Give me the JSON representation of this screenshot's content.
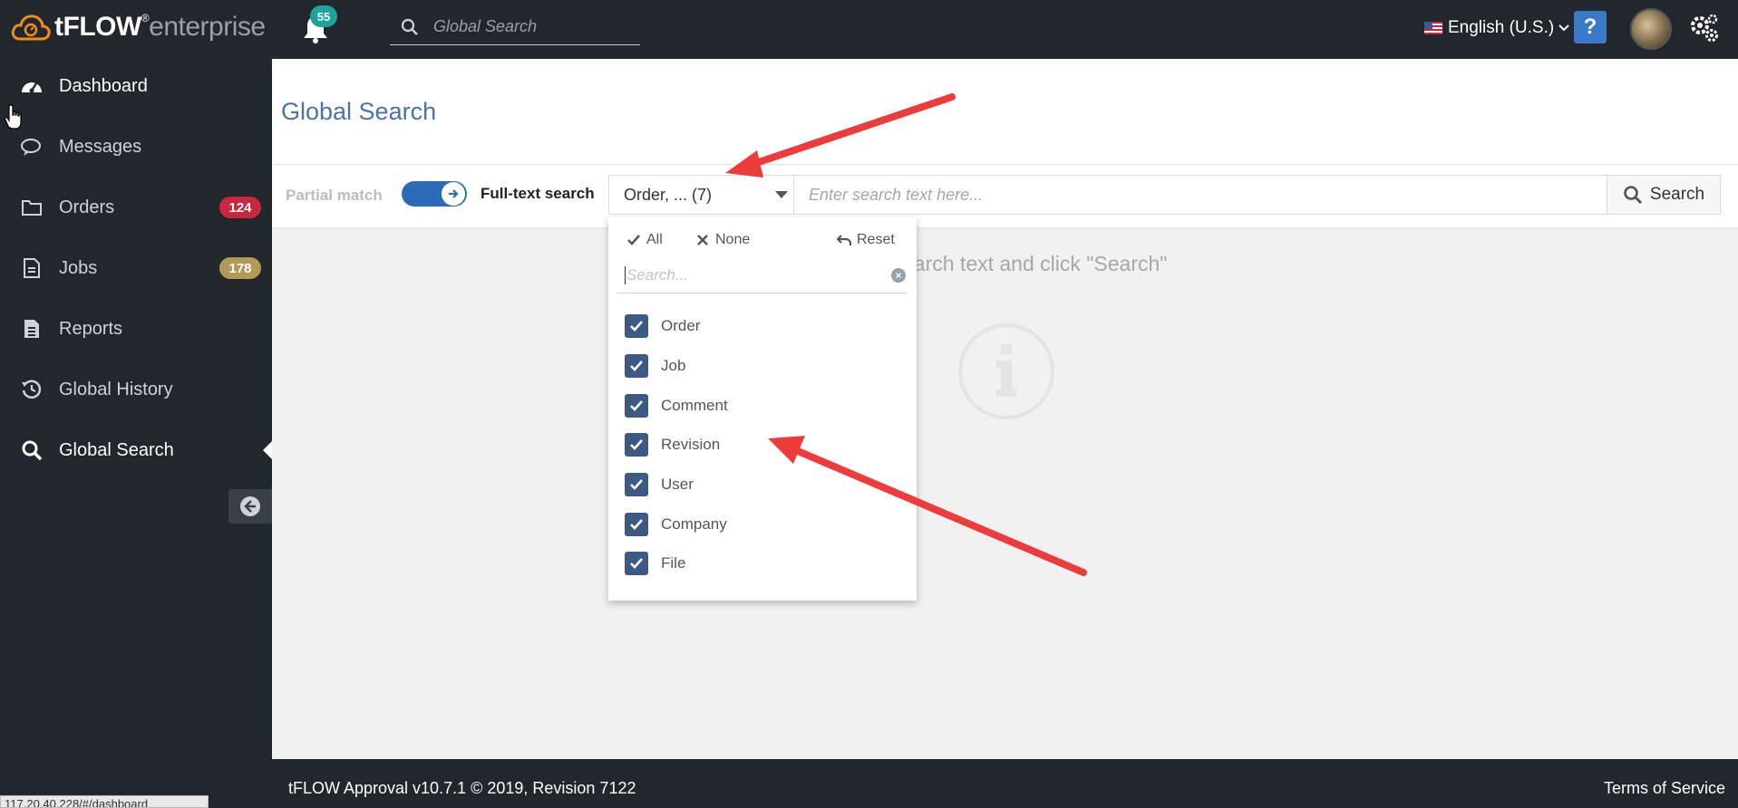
{
  "brand": {
    "name": "tFLOW",
    "registered": "®",
    "edition": "enterprise",
    "accent": "#f28c1b"
  },
  "header": {
    "notifications_count": "55",
    "search_placeholder": "Global Search",
    "language": "English (U.S.)",
    "help_label": "?"
  },
  "sidebar": {
    "items": [
      {
        "label": "Dashboard",
        "icon": "dashboard-icon"
      },
      {
        "label": "Messages",
        "icon": "messages-icon"
      },
      {
        "label": "Orders",
        "icon": "folder-icon",
        "badge": "124",
        "badge_color": "#c8283f"
      },
      {
        "label": "Jobs",
        "icon": "document-icon",
        "badge": "178",
        "badge_color": "#b19a55"
      },
      {
        "label": "Reports",
        "icon": "report-icon"
      },
      {
        "label": "Global History",
        "icon": "history-icon"
      },
      {
        "label": "Global Search",
        "icon": "search-icon",
        "active": true
      }
    ]
  },
  "page": {
    "title": "Global Search",
    "partial_match_label": "Partial match",
    "fulltext_label": "Full-text search",
    "type_select_value": "Order, ... (7)",
    "search_placeholder": "Enter search text here...",
    "search_button": "Search",
    "hint": "earch text and click \"Search\""
  },
  "dropdown": {
    "all_label": "All",
    "none_label": "None",
    "reset_label": "Reset",
    "search_placeholder": "Search...",
    "options": [
      {
        "label": "Order",
        "checked": true
      },
      {
        "label": "Job",
        "checked": true
      },
      {
        "label": "Comment",
        "checked": true
      },
      {
        "label": "Revision",
        "checked": true
      },
      {
        "label": "User",
        "checked": true
      },
      {
        "label": "Company",
        "checked": true
      },
      {
        "label": "File",
        "checked": true
      }
    ]
  },
  "footer": {
    "version": "tFLOW Approval v10.7.1 © 2019, Revision 7122",
    "terms": "Terms of Service"
  },
  "status_url": "117.20.40.228/#/dashboard"
}
